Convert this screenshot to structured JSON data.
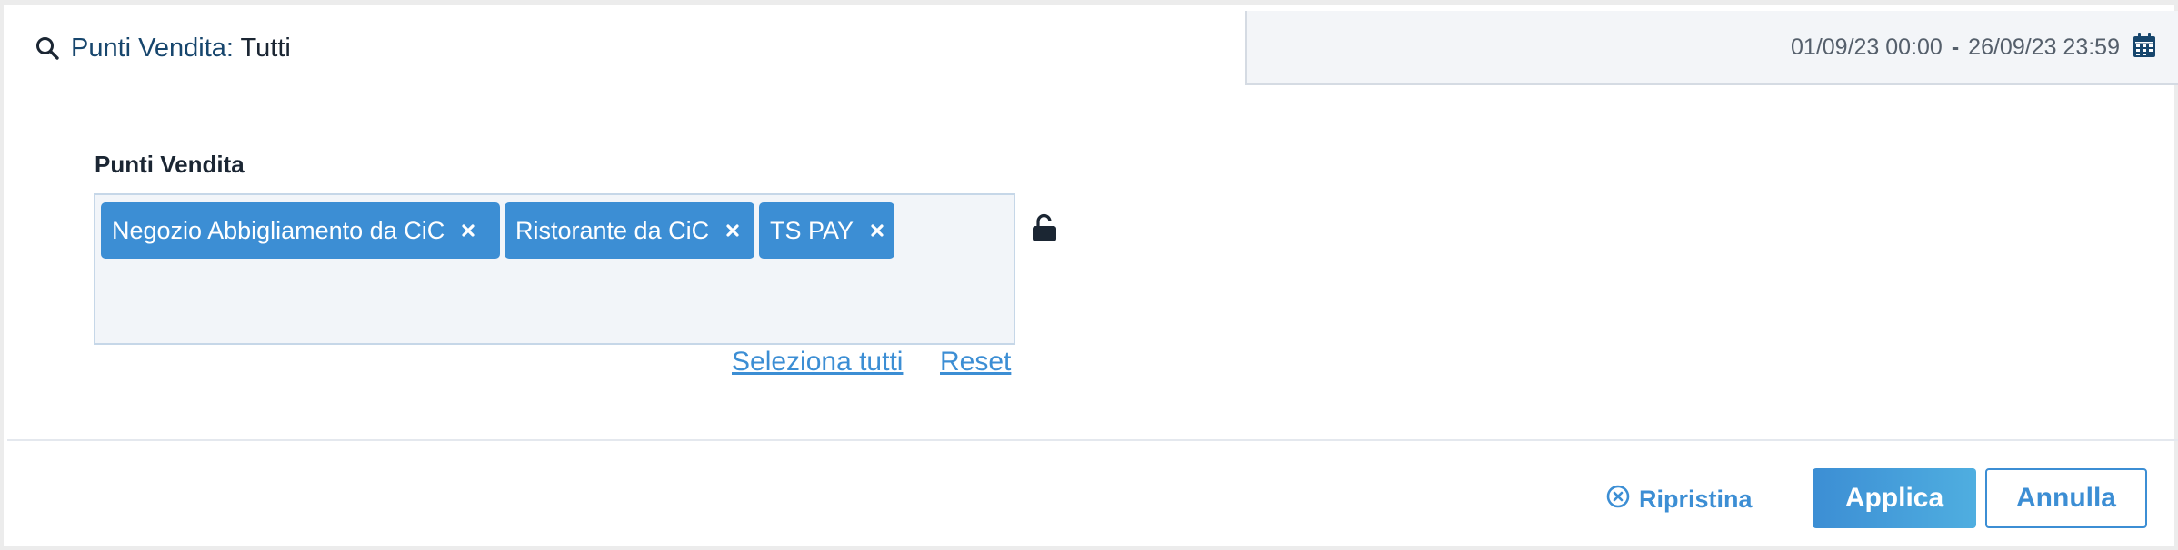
{
  "header": {
    "title_label": "Punti Vendita:",
    "title_value": "Tutti",
    "date_from": "01/09/23 00:00",
    "date_separator": "-",
    "date_to": "26/09/23 23:59",
    "search_icon": "search-icon",
    "calendar_icon": "calendar-icon"
  },
  "filter": {
    "label": "Punti Vendita",
    "tags": [
      {
        "label": "Negozio Abbigliamento da CiC"
      },
      {
        "label": "Ristorante da CiC"
      },
      {
        "label": "TS PAY"
      }
    ],
    "lock_icon": "unlock-icon",
    "select_all": "Seleziona tutti",
    "reset": "Reset"
  },
  "footer": {
    "restore_label": "Ripristina",
    "apply_label": "Applica",
    "cancel_label": "Annulla"
  },
  "colors": {
    "accent": "#3c8ed4",
    "title_blue": "#17466d",
    "tag_box_bg": "#f2f5f9"
  }
}
